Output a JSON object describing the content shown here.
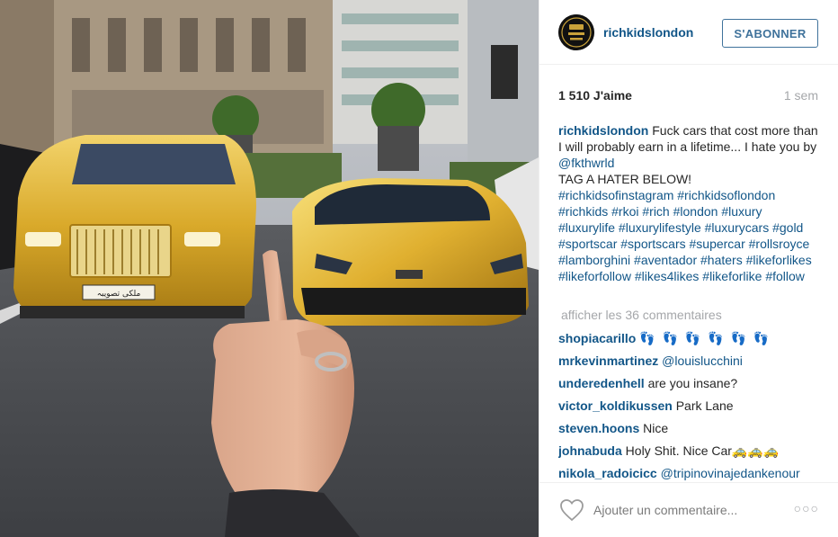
{
  "post": {
    "username": "richkidslondon",
    "follow_label": "S'ABONNER",
    "likes_text": "1 510 J'aime",
    "time_text": "1 sem",
    "caption": {
      "author": "richkidslondon",
      "text_part1": "Fuck cars that cost more than I will probably earn in a lifetime... I hate you by",
      "mention": "@fkthwrld",
      "text_part2": "TAG A HATER BELOW!",
      "hashtags": "#richkidsofinstagram #richkidsoflondon #richkids #rkoi #rich #london #luxury #luxurylife #luxurylifestyle #luxurycars #gold #sportscar #sportscars #supercar #rollsroyce #lamborghini #aventador #haters #likeforlikes #likeforfollow #likes4likes #likeforlike #follow"
    },
    "more_comments_label": "afficher les 36 commentaires",
    "comments": [
      {
        "user": "shopiacarillo",
        "text": "👣 👣 👣 👣 👣 👣"
      },
      {
        "user": "mrkevinmartinez",
        "text": "@louislucchini"
      },
      {
        "user": "underedenhell",
        "text": "are you insane?"
      },
      {
        "user": "victor_koldikussen",
        "text": "Park Lane"
      },
      {
        "user": "steven.hoons",
        "text": "Nice"
      },
      {
        "user": "johnabuda",
        "text": "Holy Shit. Nice Car🚕🚕🚕"
      },
      {
        "user": "nikola_radoicicc",
        "text": "@tripinovinajedankenour"
      }
    ],
    "comment_placeholder": "Ajouter un commentaire...",
    "more_options": "○○○",
    "plate_text": "ملکی تصویبہ"
  },
  "colors": {
    "link_blue": "#125688",
    "follow_blue": "#3f729b",
    "muted_gray": "#a5a7aa",
    "gold": "#d4a82a"
  }
}
